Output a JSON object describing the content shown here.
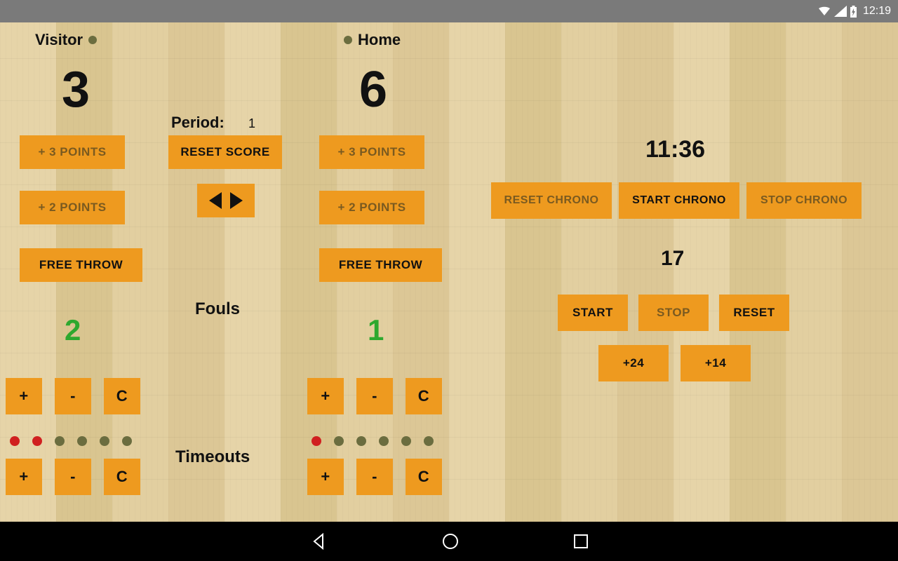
{
  "status": {
    "time": "12:19"
  },
  "teams": {
    "visitor": {
      "label": "Visitor",
      "score": "3",
      "fouls": "2",
      "timeouts_used": 2,
      "timeouts_total": 6
    },
    "home": {
      "label": "Home",
      "score": "6",
      "fouls": "1",
      "timeouts_used": 1,
      "timeouts_total": 6
    }
  },
  "period": {
    "label": "Period:",
    "value": "1"
  },
  "labels": {
    "fouls": "Fouls",
    "timeouts": "Timeouts"
  },
  "buttons": {
    "plus3": "+ 3 POINTS",
    "plus2": "+ 2 POINTS",
    "freethrow": "FREE THROW",
    "reset_score": "RESET SCORE",
    "plus": "+",
    "minus": "-",
    "clear": "C",
    "reset_chrono": "RESET CHRONO",
    "start_chrono": "START CHRONO",
    "stop_chrono": "STOP CHRONO",
    "start": "START",
    "stop": "STOP",
    "reset": "RESET",
    "plus24": "+24",
    "plus14": "+14"
  },
  "chrono": {
    "time": "11:36",
    "shot_clock": "17"
  }
}
